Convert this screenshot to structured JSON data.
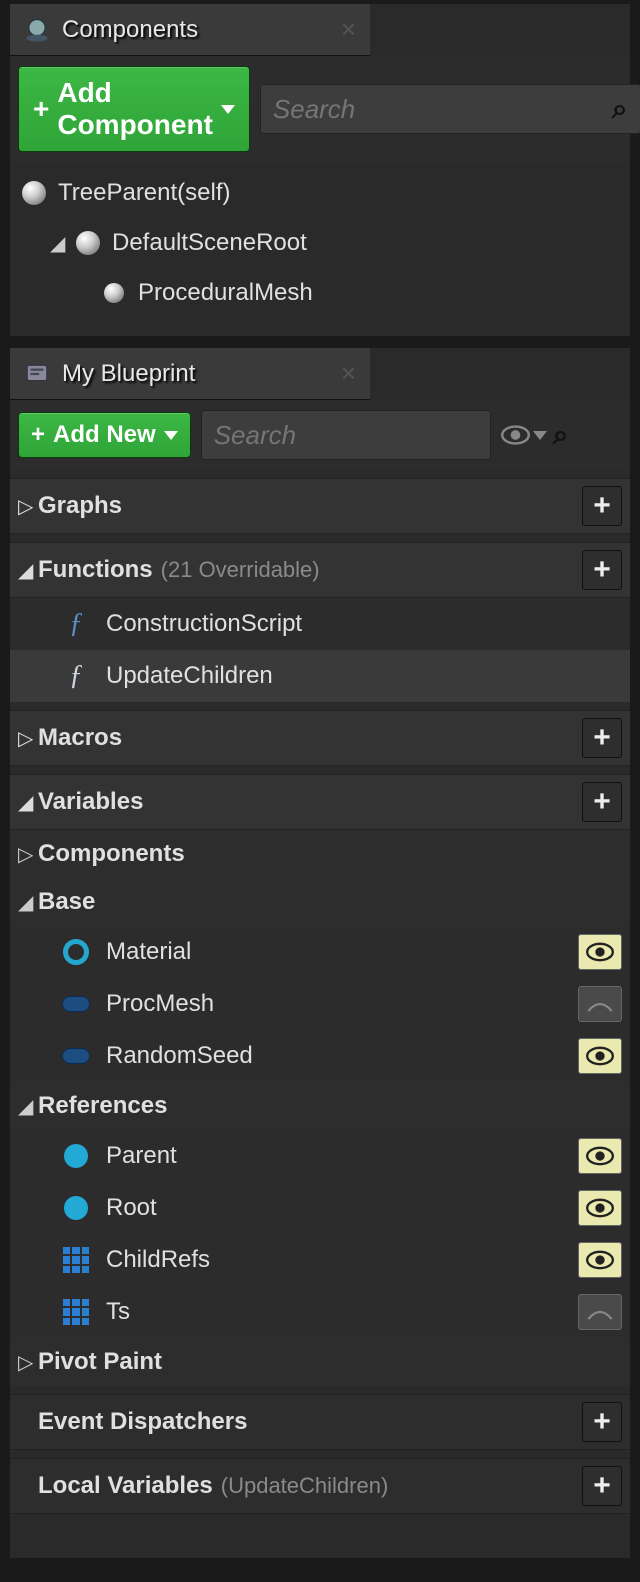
{
  "components_panel": {
    "title": "Components",
    "add_button": "Add Component",
    "search_placeholder": "Search",
    "tree": {
      "root": "TreeParent(self)",
      "scene_root": "DefaultSceneRoot",
      "child1": "ProceduralMesh"
    }
  },
  "blueprint_panel": {
    "title": "My Blueprint",
    "add_button": "Add New",
    "search_placeholder": "Search",
    "sections": {
      "graphs": {
        "title": "Graphs"
      },
      "functions": {
        "title": "Functions",
        "subtitle": "(21 Overridable)",
        "items": {
          "construction": "ConstructionScript",
          "update_children": "UpdateChildren"
        }
      },
      "macros": {
        "title": "Macros"
      },
      "variables": {
        "title": "Variables",
        "categories": {
          "components": "Components",
          "base": "Base",
          "references": "References",
          "pivot_paint": "Pivot Paint"
        },
        "base_items": {
          "material": "Material",
          "procmesh": "ProcMesh",
          "randomseed": "RandomSeed"
        },
        "ref_items": {
          "parent": "Parent",
          "root": "Root",
          "childrefs": "ChildRefs",
          "ts": "Ts"
        }
      },
      "event_dispatchers": {
        "title": "Event Dispatchers"
      },
      "local_variables": {
        "title": "Local Variables",
        "subtitle": "(UpdateChildren)"
      }
    }
  }
}
